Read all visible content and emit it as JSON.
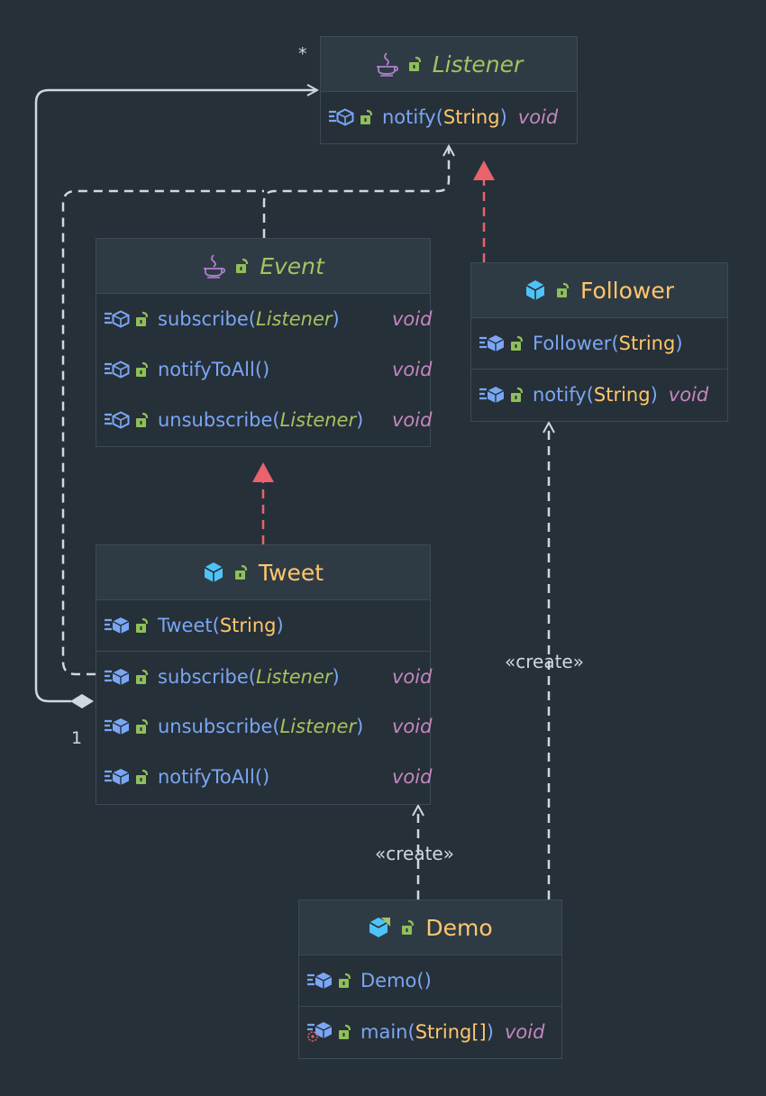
{
  "colors": {
    "background": "#263038",
    "header_bg": "#2f3b44",
    "border": "#3c4a55",
    "class_name": "#ffc66d",
    "interface_name": "#a5c261",
    "method": "#7aa6f5",
    "type": "#ffc66d",
    "return_type": "#c586c0",
    "edge": "#cfd8dc",
    "realization_arrow": "#e8636b"
  },
  "classes": {
    "listener": {
      "name": "Listener",
      "kind": "interface",
      "methods": [
        {
          "name": "notify",
          "open": "(",
          "param": "String",
          "close": ")",
          "ret": "void"
        }
      ]
    },
    "event": {
      "name": "Event",
      "kind": "interface",
      "methods": [
        {
          "name": "subscribe",
          "open": "(",
          "param": "Listener",
          "close": ")",
          "ret": "void"
        },
        {
          "name": "notifyToAll",
          "open": "(",
          "param": "",
          "close": ")",
          "ret": "void"
        },
        {
          "name": "unsubscribe",
          "open": "(",
          "param": "Listener",
          "close": ")",
          "ret": "void"
        }
      ]
    },
    "follower": {
      "name": "Follower",
      "kind": "class",
      "constructor": {
        "name": "Follower",
        "open": "(",
        "param": "String",
        "close": ")"
      },
      "methods": [
        {
          "name": "notify",
          "open": "(",
          "param": "String",
          "close": ")",
          "ret": "void"
        }
      ]
    },
    "tweet": {
      "name": "Tweet",
      "kind": "class",
      "constructor": {
        "name": "Tweet",
        "open": "(",
        "param": "String",
        "close": ")"
      },
      "methods": [
        {
          "name": "subscribe",
          "open": "(",
          "param": "Listener",
          "close": ")",
          "ret": "void"
        },
        {
          "name": "unsubscribe",
          "open": "(",
          "param": "Listener",
          "close": ")",
          "ret": "void"
        },
        {
          "name": "notifyToAll",
          "open": "(",
          "param": "",
          "close": ")",
          "ret": "void"
        }
      ]
    },
    "demo": {
      "name": "Demo",
      "kind": "class",
      "constructor": {
        "name": "Demo",
        "open": "(",
        "param": "",
        "close": ")"
      },
      "methods": [
        {
          "name": "main",
          "open": "(",
          "param": "String[]",
          "close": ")",
          "ret": "void"
        }
      ]
    }
  },
  "relations": {
    "create_label": "«create»",
    "aggregation_multiplicity_listener": "*",
    "aggregation_multiplicity_tweet": "1"
  },
  "icons": {
    "interface": "java-interface-icon",
    "class": "class-cube-icon",
    "main_class": "main-class-icon",
    "method": "method-icon",
    "visibility": "public-unlock-icon"
  }
}
